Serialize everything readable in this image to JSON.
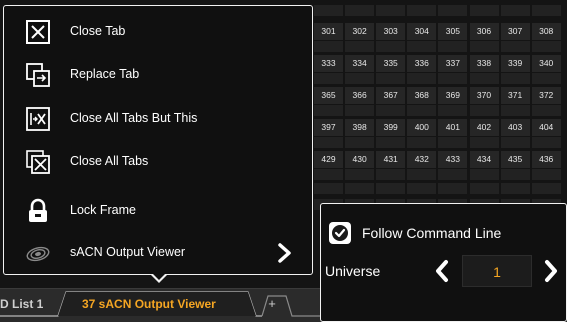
{
  "grid": {
    "rows": [
      [
        "301",
        "302",
        "303",
        "304",
        "305",
        "306",
        "307",
        "308"
      ],
      [
        "333",
        "334",
        "335",
        "336",
        "337",
        "338",
        "339",
        "340"
      ],
      [
        "365",
        "366",
        "367",
        "368",
        "369",
        "370",
        "371",
        "372"
      ],
      [
        "397",
        "398",
        "399",
        "400",
        "401",
        "402",
        "403",
        "404"
      ],
      [
        "429",
        "430",
        "431",
        "432",
        "433",
        "434",
        "435",
        "436"
      ]
    ]
  },
  "menu": {
    "items": [
      {
        "label": "Close Tab",
        "icon": "close-tab-icon"
      },
      {
        "label": "Replace Tab",
        "icon": "replace-tab-icon"
      },
      {
        "label": "Close All Tabs But This",
        "icon": "close-all-but-this-icon"
      },
      {
        "label": "Close All Tabs",
        "icon": "close-all-tabs-icon"
      },
      {
        "label": "Lock Frame",
        "icon": "lock-icon"
      },
      {
        "label": "sACN Output Viewer",
        "icon": "sacn-icon",
        "submenu": true
      }
    ]
  },
  "tabs": {
    "partial": "D List 1",
    "active": "37 sACN Output Viewer",
    "add": "+"
  },
  "popup": {
    "follow_command_line": "Follow Command Line",
    "follow_checked": true,
    "universe_label": "Universe",
    "universe_value": "1"
  },
  "colors": {
    "accent": "#f5a623",
    "border": "#f2f2f2",
    "panel": "#101010"
  }
}
